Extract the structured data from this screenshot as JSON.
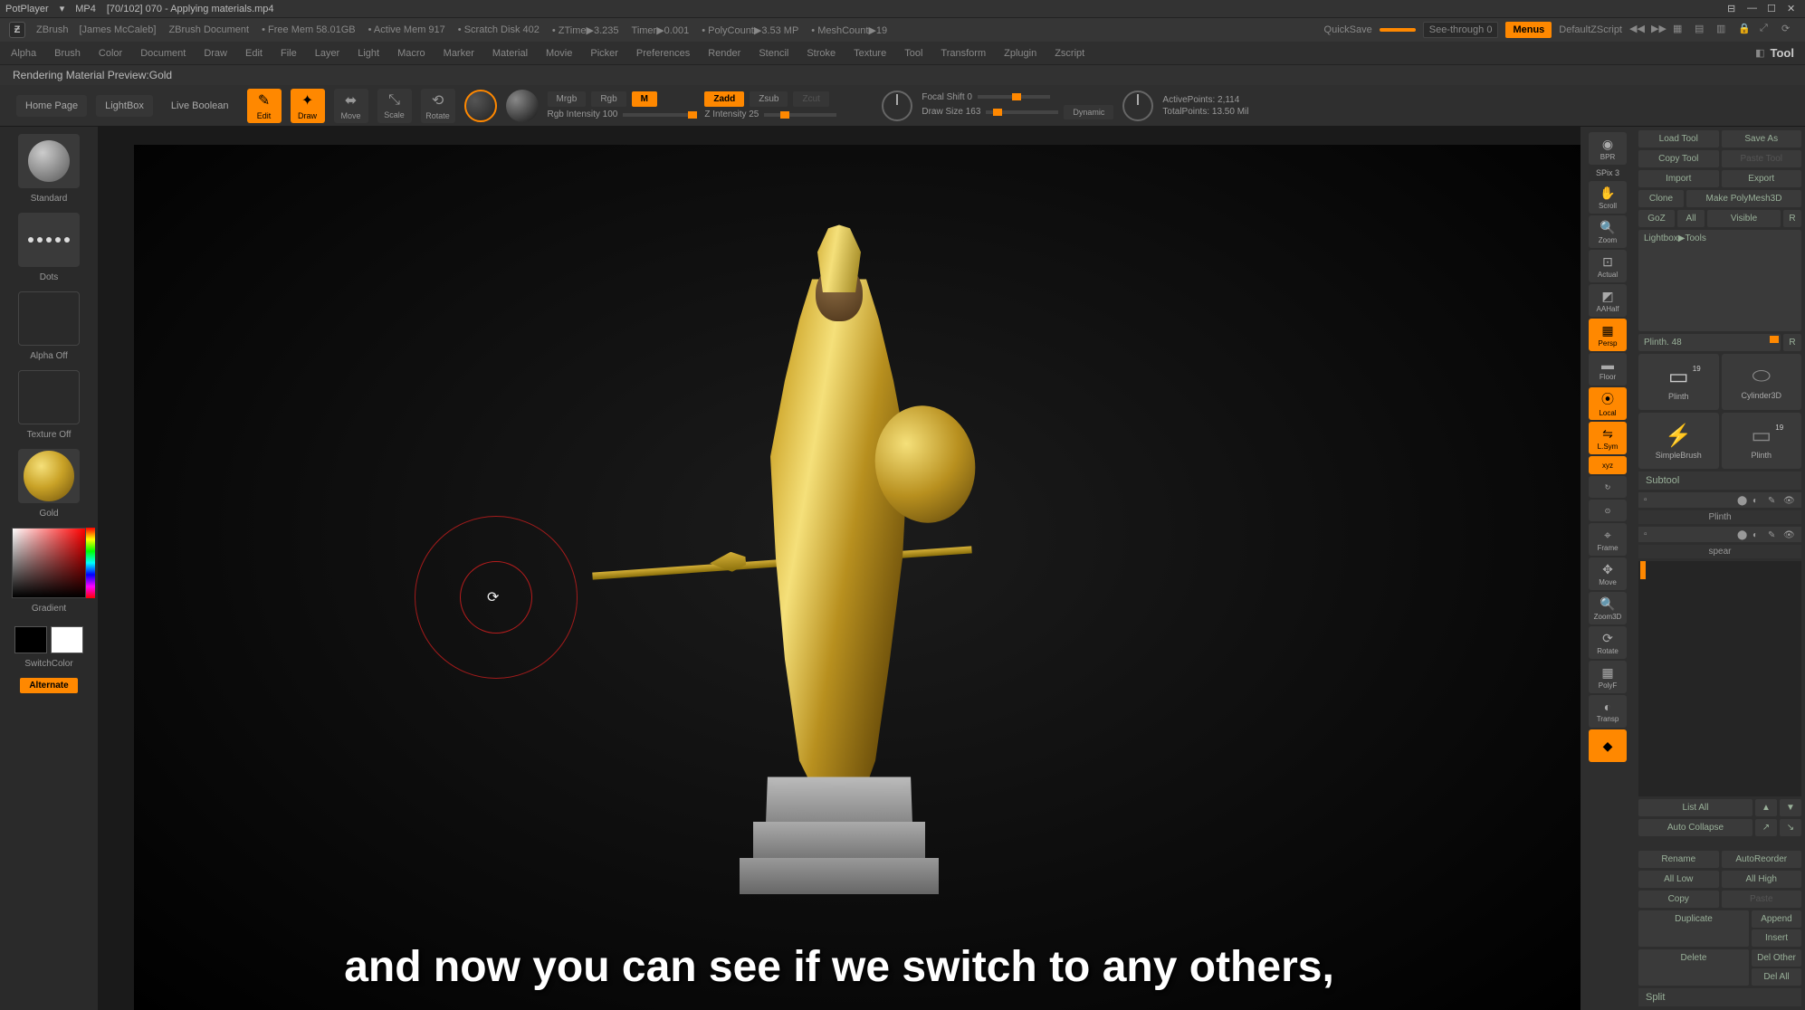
{
  "potplayer": {
    "name": "PotPlayer",
    "mp4": "MP4",
    "file": "[70/102] 070 - Applying materials.mp4"
  },
  "header": {
    "app": "ZBrush",
    "user": "[James McCaleb]",
    "doc": "ZBrush Document",
    "freemem": "• Free Mem 58.01GB",
    "activemem": "• Active Mem 917",
    "scratch": "• Scratch Disk 402",
    "ztime": "• ZTime▶3.235",
    "timer": "Timer▶0.001",
    "polycount": "• PolyCount▶3.53 MP",
    "meshcount": "• MeshCount▶19",
    "quicksave": "QuickSave",
    "seethrough": "See-through  0",
    "menus": "Menus",
    "defaultscript": "DefaultZScript"
  },
  "menu": {
    "items": [
      "Alpha",
      "Brush",
      "Color",
      "Document",
      "Draw",
      "Edit",
      "File",
      "Layer",
      "Light",
      "Macro",
      "Marker",
      "Material",
      "Movie",
      "Picker",
      "Preferences",
      "Render",
      "Stencil",
      "Stroke",
      "Texture",
      "Tool",
      "Transform",
      "Zplugin",
      "Zscript"
    ],
    "tool": "Tool"
  },
  "info": "Rendering Material Preview:Gold",
  "toolbar": {
    "home": "Home Page",
    "lightbox": "LightBox",
    "live": "Live Boolean",
    "edit": "Edit",
    "draw": "Draw",
    "move": "Move",
    "scale": "Scale",
    "rotate": "Rotate",
    "mrgb": "Mrgb",
    "rgb": "Rgb",
    "m": "M",
    "zadd": "Zadd",
    "zsub": "Zsub",
    "zcut": "Zcut",
    "rgb_intensity": "Rgb Intensity 100",
    "z_intensity": "Z Intensity 25",
    "focal_shift": "Focal Shift 0",
    "draw_size": "Draw Size 163",
    "dynamic": "Dynamic",
    "active_points": "ActivePoints: 2,114",
    "total_points": "TotalPoints: 13.50 Mil"
  },
  "left": {
    "standard": "Standard",
    "dots": "Dots",
    "alpha_off": "Alpha Off",
    "texture_off": "Texture Off",
    "gold": "Gold",
    "gradient": "Gradient",
    "switchcolor": "SwitchColor",
    "alternate": "Alternate"
  },
  "nav": {
    "bpr": "BPR",
    "spix": "SPix 3",
    "scroll": "Scroll",
    "zoom": "Zoom",
    "actual": "Actual",
    "aahalf": "AAHalf",
    "persp": "Persp",
    "floor": "Floor",
    "local": "Local",
    "lsym": "L.Sym",
    "xyz": "xyz",
    "frame": "Frame",
    "move": "Move",
    "zoom3d": "Zoom3D",
    "rotate": "Rotate",
    "polyf": "PolyF",
    "transp": "Transp"
  },
  "tool": {
    "load": "Load Tool",
    "saveas": "Save As",
    "copy": "Copy Tool",
    "paste": "Paste Tool",
    "import": "Import",
    "export": "Export",
    "clone": "Clone",
    "makepoly": "Make PolyMesh3D",
    "goz": "GoZ",
    "all": "All",
    "visible": "Visible",
    "r": "R",
    "lightbox_tools": "Lightbox▶Tools",
    "plinth": "Plinth. 48",
    "r2": "R",
    "items": [
      "Plinth",
      "Cylinder3D",
      "SimpleBrush",
      "Plinth"
    ],
    "count19": "19",
    "subtool_header": "Subtool",
    "subtool1": "Plinth",
    "subtool2": "spear",
    "listall": "List All",
    "autocollapse": "Auto Collapse",
    "rename": "Rename",
    "autoreorder": "AutoReorder",
    "alllow": "All Low",
    "allhigh": "All High",
    "copy2": "Copy",
    "paste2": "Paste",
    "duplicate": "Duplicate",
    "append": "Append",
    "insert": "Insert",
    "delete": "Delete",
    "delother": "Del Other",
    "delall": "Del All",
    "split": "Split"
  },
  "subtitle": "and now you can see if we switch to any others,"
}
